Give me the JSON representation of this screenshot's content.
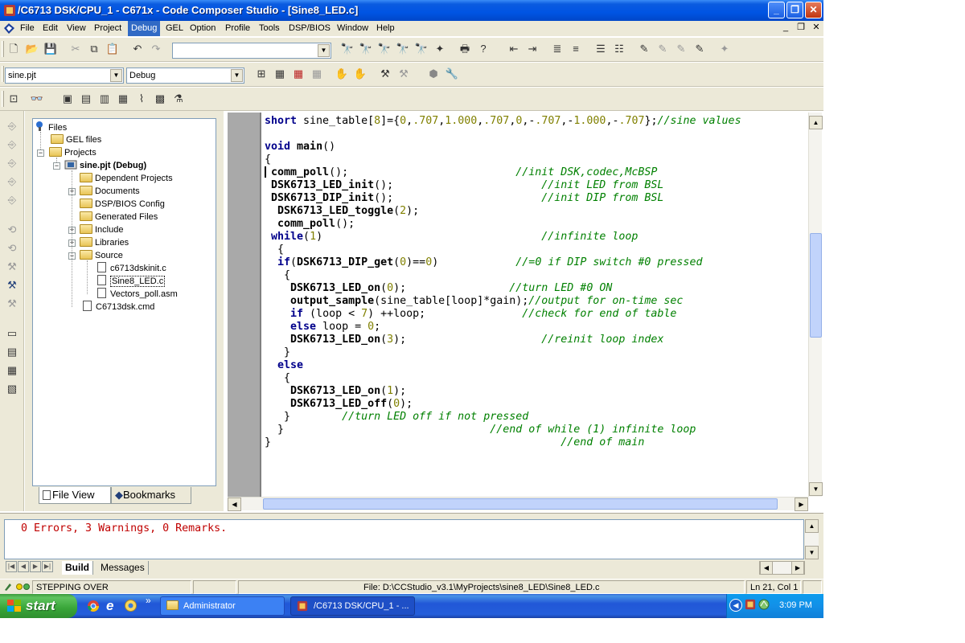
{
  "window": {
    "title": "/C6713 DSK/CPU_1 - C671x - Code Composer Studio - [Sine8_LED.c]",
    "controls": {
      "minimize": "_",
      "restore": "❐",
      "close": "✕"
    }
  },
  "menubar": {
    "items": [
      "File",
      "Edit",
      "View",
      "Project",
      "Debug",
      "GEL",
      "Option",
      "Profile",
      "Tools",
      "DSP/BIOS",
      "Window",
      "Help"
    ],
    "active": "Debug",
    "mdi_controls": {
      "minimize": "_",
      "restore": "❐",
      "close": "✕"
    }
  },
  "toolbar": {
    "search_combo_value": "",
    "project_combo_value": "sine.pjt",
    "config_combo_value": "Debug"
  },
  "tree": {
    "root": "Files",
    "gel": "GEL files",
    "projects": "Projects",
    "project": "sine.pjt (Debug)",
    "folders": [
      "Dependent Projects",
      "Documents",
      "DSP/BIOS Config",
      "Generated Files",
      "Include",
      "Libraries",
      "Source"
    ],
    "source_files": [
      "c6713dskinit.c",
      "Sine8_LED.c",
      "Vectors_poll.asm"
    ],
    "cmd_file": "C6713dsk.cmd"
  },
  "tree_tabs": {
    "file_view": "File View",
    "bookmarks": "Bookmarks"
  },
  "editor": {
    "filename": "Sine8_LED.c",
    "lines": [
      "short sine_table[8]={0,.707,1.000,.707,0,-.707,-1.000,-.707};//sine values",
      "",
      "void main()",
      "{",
      " comm_poll();                          //init DSK,codec,McBSP",
      " DSK6713_LED_init();                       //init LED from BSL",
      " DSK6713_DIP_init();                       //init DIP from BSL",
      "  DSK6713_LED_toggle(2);",
      "  comm_poll();",
      " while(1)                                  //infinite loop",
      "  {",
      "  if(DSK6713_DIP_get(0)==0)            //=0 if DIP switch #0 pressed",
      "   {",
      "    DSK6713_LED_on(0);                //turn LED #0 ON",
      "    output_sample(sine_table[loop]*gain);//output for on-time sec",
      "    if (loop < 7) ++loop;               //check for end of table",
      "    else loop = 0;",
      "    DSK6713_LED_on(3);                     //reinit loop index",
      "   }",
      "  else",
      "   {",
      "    DSK6713_LED_on(1);",
      "    DSK6713_LED_off(0);",
      "   }        //turn LED off if not pressed",
      "  }                                //end of while (1) infinite loop",
      "}                                             //end of main"
    ]
  },
  "output": {
    "message": "0 Errors, 3 Warnings, 0 Remarks.",
    "tabs": [
      "Build",
      "Messages"
    ],
    "active_tab": "Build"
  },
  "statusbar": {
    "state": "STEPPING OVER",
    "file": "File: D:\\CCStudio_v3.1\\MyProjects\\sine8_LED\\Sine8_LED.c",
    "position": "Ln 21, Col 1"
  },
  "taskbar": {
    "start": "start",
    "tasks": [
      "Administrator",
      "/C6713 DSK/CPU_1 - ..."
    ],
    "clock": "3:09 PM",
    "quicklaunch_more": "»"
  }
}
